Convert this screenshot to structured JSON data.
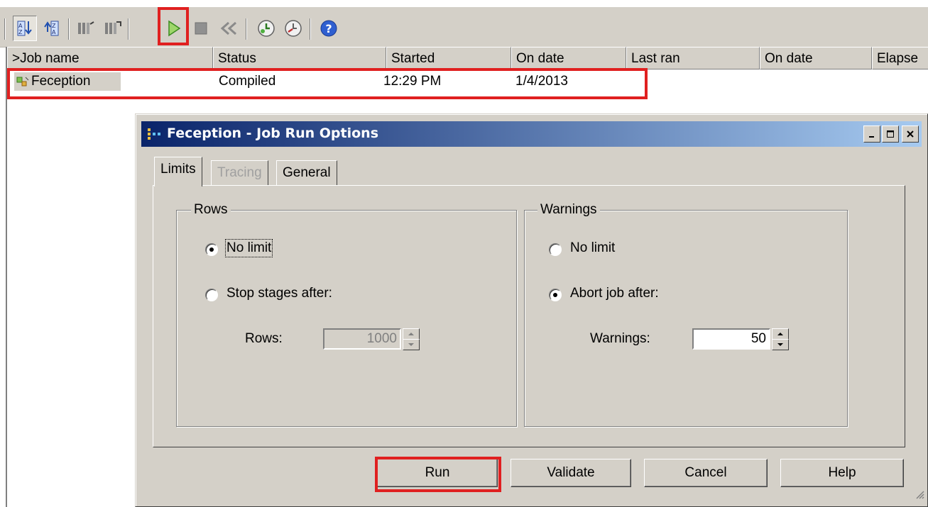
{
  "toolbar": {
    "buttons": [
      "sort-ascending-icon",
      "sort-descending-icon",
      "properties-icon",
      "properties-2-icon",
      "run-icon",
      "stop-icon",
      "reset-icon",
      "schedule-icon",
      "unschedule-icon",
      "help-icon"
    ]
  },
  "job_list": {
    "columns": [
      ">Job name",
      "Status",
      "Started",
      "On date",
      "Last ran",
      "On date",
      "Elapse"
    ],
    "rows": [
      {
        "job_name": "Feception",
        "status": "Compiled",
        "started": "12:29 PM",
        "on_date": "1/4/2013"
      }
    ]
  },
  "dialog": {
    "title": "Feception - Job Run Options",
    "tabs": [
      "Limits",
      "Tracing",
      "General"
    ],
    "active_tab": "Limits",
    "rows_group": {
      "label": "Rows",
      "no_limit": "No limit",
      "stop_after": "Stop stages after:",
      "field_label": "Rows:",
      "field_value": "1000",
      "selected": "No limit"
    },
    "warnings_group": {
      "label": "Warnings",
      "no_limit": "No limit",
      "abort_after": "Abort job after:",
      "field_label": "Warnings:",
      "field_value": "50",
      "selected": "Abort job after:"
    },
    "buttons": {
      "run": "Run",
      "validate": "Validate",
      "cancel": "Cancel",
      "help": "Help"
    }
  },
  "colors": {
    "highlight": "#e02020",
    "titlebar_start": "#0a246a",
    "titlebar_end": "#a6caf0",
    "face": "#d4d0c8"
  }
}
